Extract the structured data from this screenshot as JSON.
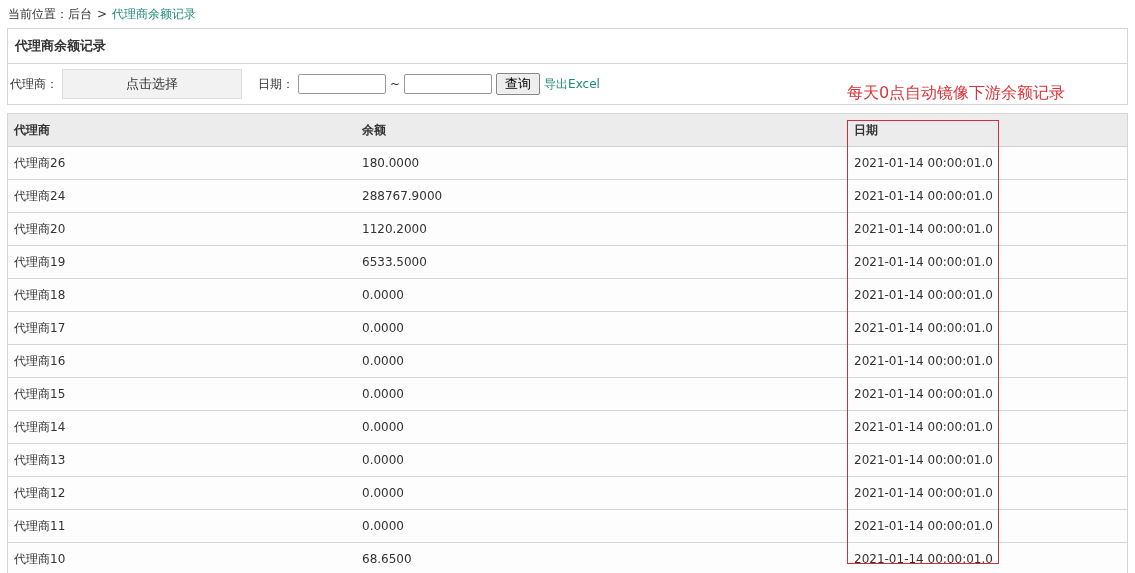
{
  "breadcrumb": {
    "label": "当前位置：后台",
    "separator": ">",
    "current": "代理商余额记录"
  },
  "panel": {
    "title": "代理商余额记录"
  },
  "filters": {
    "agent_label": "代理商：",
    "agent_button": "点击选择",
    "date_label": "日期：",
    "range_separator": "~",
    "query_button": "查询",
    "export_link": "导出Excel"
  },
  "annotation": {
    "text": "每天0点自动镜像下游余额记录"
  },
  "table": {
    "columns": [
      "代理商",
      "余额",
      "日期"
    ],
    "rows": [
      [
        "代理商26",
        "180.0000",
        "2021-01-14 00:00:01.0"
      ],
      [
        "代理商24",
        "288767.9000",
        "2021-01-14 00:00:01.0"
      ],
      [
        "代理商20",
        "1120.2000",
        "2021-01-14 00:00:01.0"
      ],
      [
        "代理商19",
        "6533.5000",
        "2021-01-14 00:00:01.0"
      ],
      [
        "代理商18",
        "0.0000",
        "2021-01-14 00:00:01.0"
      ],
      [
        "代理商17",
        "0.0000",
        "2021-01-14 00:00:01.0"
      ],
      [
        "代理商16",
        "0.0000",
        "2021-01-14 00:00:01.0"
      ],
      [
        "代理商15",
        "0.0000",
        "2021-01-14 00:00:01.0"
      ],
      [
        "代理商14",
        "0.0000",
        "2021-01-14 00:00:01.0"
      ],
      [
        "代理商13",
        "0.0000",
        "2021-01-14 00:00:01.0"
      ],
      [
        "代理商12",
        "0.0000",
        "2021-01-14 00:00:01.0"
      ],
      [
        "代理商11",
        "0.0000",
        "2021-01-14 00:00:01.0"
      ],
      [
        "代理商10",
        "68.6500",
        "2021-01-14 00:00:01.0"
      ]
    ]
  }
}
